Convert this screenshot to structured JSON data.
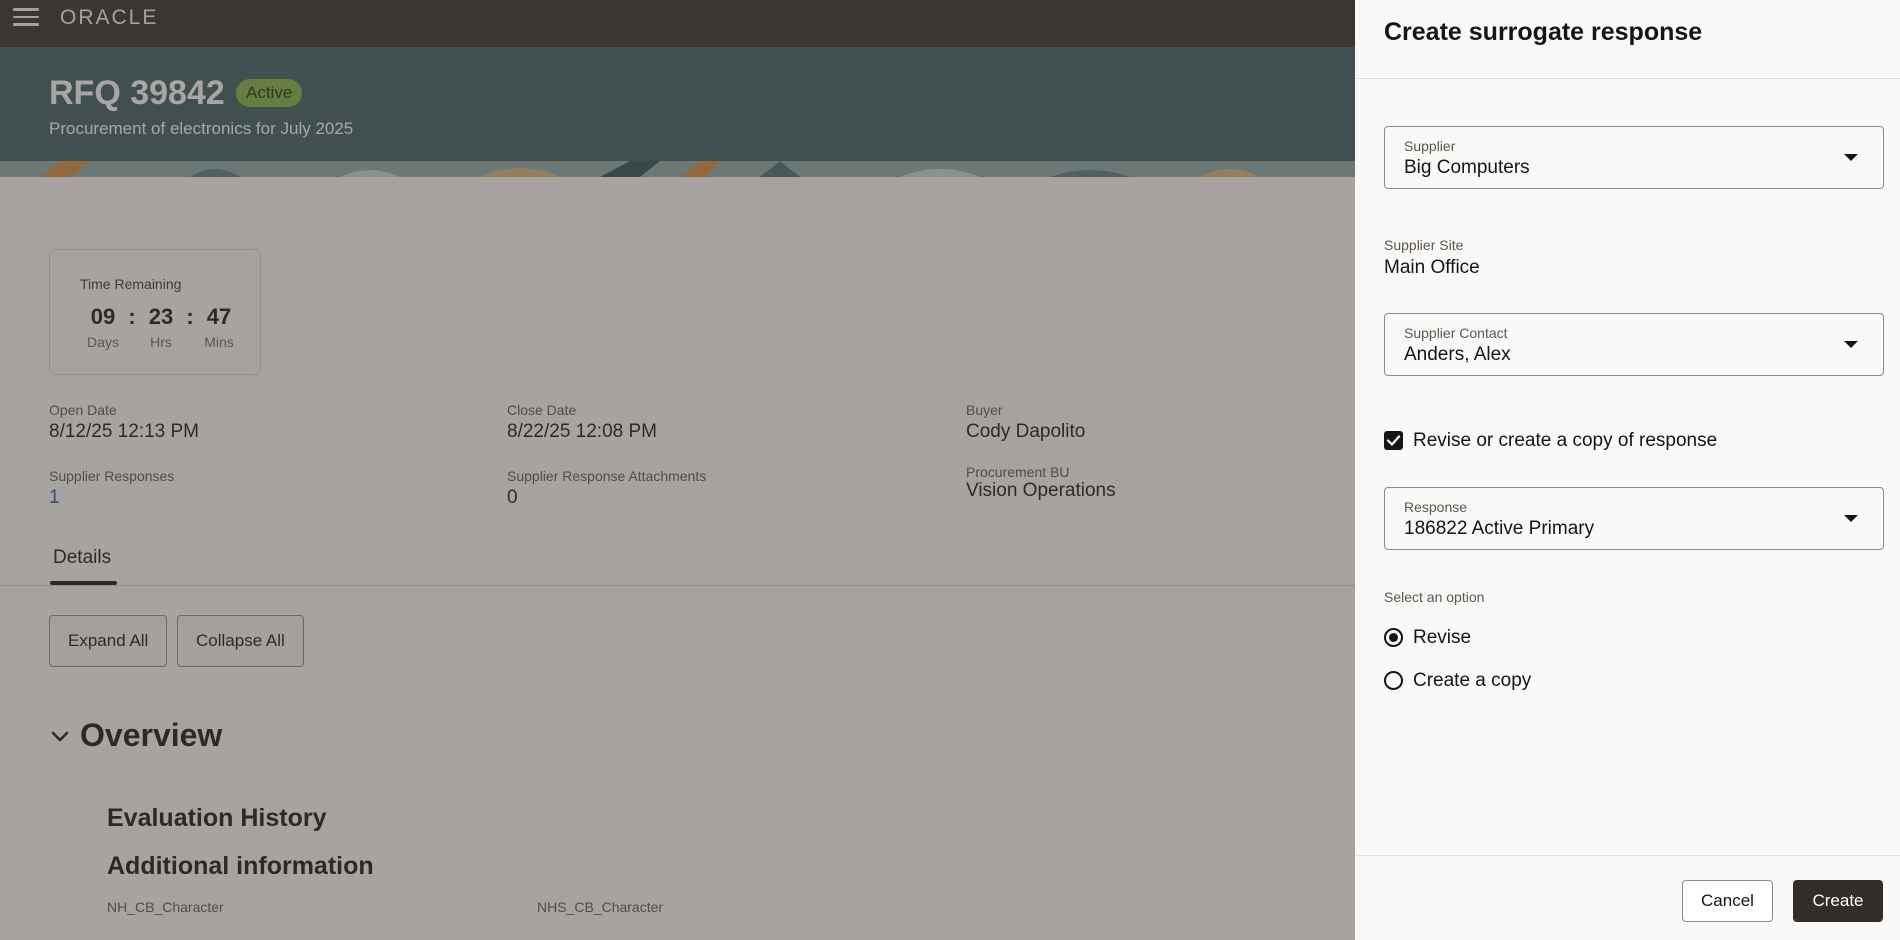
{
  "header": {
    "logo": "ORACLE",
    "menu_icon": "hamburger-menu-icon"
  },
  "rfq": {
    "title": "RFQ 39842",
    "status": "Active",
    "subtitle": "Procurement of electronics for July 2025"
  },
  "timer": {
    "label": "Time Remaining",
    "days": "09",
    "hours": "23",
    "mins": "47",
    "days_label": "Days",
    "hours_label": "Hrs",
    "mins_label": "Mins",
    "separator": ":"
  },
  "fields": {
    "open_date_label": "Open Date",
    "open_date": "8/12/25 12:13 PM",
    "close_date_label": "Close Date",
    "close_date": "8/22/25 12:08 PM",
    "buyer_label": "Buyer",
    "buyer": "Cody Dapolito",
    "supplier_responses_label": "Supplier Responses",
    "supplier_responses": "1",
    "attachments_label": "Supplier Response Attachments",
    "attachments": "0",
    "procurement_bu_label": "Procurement BU",
    "procurement_bu": "Vision Operations"
  },
  "tabs": {
    "details": "Details"
  },
  "actions": {
    "expand_all": "Expand All",
    "collapse_all": "Collapse All"
  },
  "overview": {
    "title": "Overview",
    "evaluation_history": "Evaluation History",
    "additional_information": "Additional information",
    "attr1": "NH_CB_Character",
    "attr2": "NHS_CB_Character"
  },
  "drawer": {
    "title": "Create surrogate response",
    "supplier_label": "Supplier",
    "supplier_value": "Big Computers",
    "supplier_site_label": "Supplier Site",
    "supplier_site_value": "Main Office",
    "supplier_contact_label": "Supplier Contact",
    "supplier_contact_value": "Anders, Alex",
    "revise_copy_label": "Revise or create a copy of response",
    "revise_copy_checked": true,
    "response_label": "Response",
    "response_value": "186822 Active Primary",
    "option_label": "Select an option",
    "option_revise": "Revise",
    "option_copy": "Create a copy",
    "selected_option": "Revise",
    "cancel": "Cancel",
    "create": "Create"
  },
  "colors": {
    "topbar": "#312d2a",
    "hero": "#3e5c62",
    "badge": "#81b441",
    "link": "#1d5b9d",
    "primary_button": "#312d2a"
  }
}
